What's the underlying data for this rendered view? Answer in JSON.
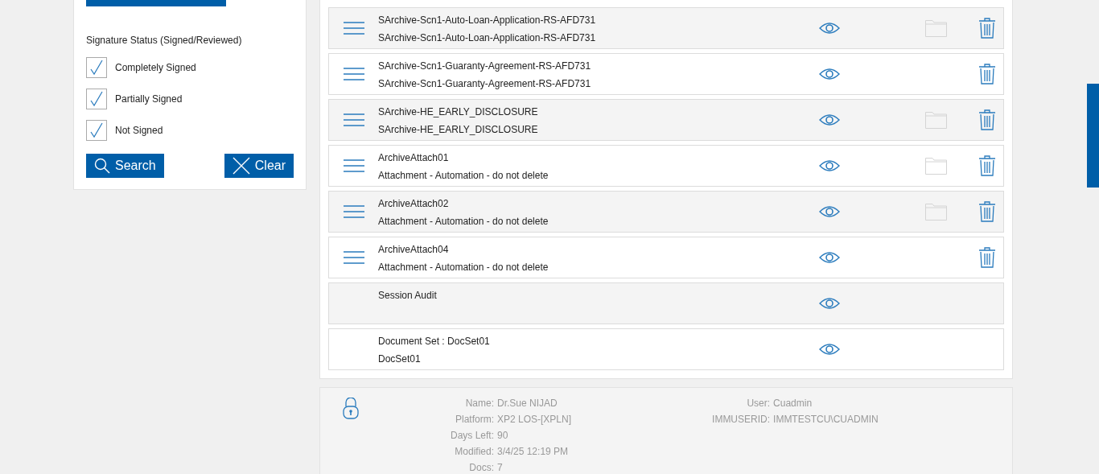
{
  "filter_panel": {
    "section_label": "Signature Status (Signed/Reviewed)",
    "options": [
      {
        "label": "Completely Signed",
        "checked": true
      },
      {
        "label": "Partially Signed",
        "checked": true
      },
      {
        "label": "Not Signed",
        "checked": true
      }
    ],
    "buttons": [
      {
        "kind": "search",
        "label": "Search"
      },
      {
        "kind": "clear",
        "label": "Clear"
      }
    ]
  },
  "documents": [
    {
      "title": "SArchive-Scn1-Auto-Loan-Application-RS-AFD731",
      "subtitle": "SArchive-Scn1-Auto-Loan-Application-RS-AFD731",
      "menu": true,
      "folder": true,
      "trash": true
    },
    {
      "title": "SArchive-Scn1-Guaranty-Agreement-RS-AFD731",
      "subtitle": "SArchive-Scn1-Guaranty-Agreement-RS-AFD731",
      "menu": true,
      "folder": false,
      "trash": true
    },
    {
      "title": "SArchive-HE_EARLY_DISCLOSURE",
      "subtitle": "SArchive-HE_EARLY_DISCLOSURE",
      "menu": true,
      "folder": true,
      "trash": true
    },
    {
      "title": "ArchiveAttach01",
      "subtitle": "Attachment - Automation - do not delete",
      "menu": true,
      "folder": true,
      "trash": true
    },
    {
      "title": "ArchiveAttach02",
      "subtitle": "Attachment - Automation - do not delete",
      "menu": true,
      "folder": true,
      "trash": true
    },
    {
      "title": "ArchiveAttach04",
      "subtitle": "Attachment - Automation - do not delete",
      "menu": true,
      "folder": false,
      "trash": true
    },
    {
      "title": "Session Audit",
      "menu": false,
      "folder": false,
      "trash": false
    },
    {
      "title": "Document Set : DocSet01",
      "subtitle": "DocSet01",
      "menu": false,
      "folder": false,
      "trash": false
    }
  ],
  "info": {
    "left": [
      {
        "label": "Name:",
        "value": "Dr.Sue NIJAD"
      },
      {
        "label": "Platform:",
        "value": "XP2 LOS-[XPLN]"
      },
      {
        "label": "Days Left:",
        "value": "90"
      },
      {
        "label": "Modified:",
        "value": "3/4/25 12:19 PM"
      },
      {
        "label": "Docs:",
        "value": "7"
      }
    ],
    "right": [
      {
        "label": "User:",
        "value": "Cuadmin"
      },
      {
        "label": "IMMUSERID:",
        "value": "IMMTESTCU\\CUADMIN"
      }
    ]
  }
}
